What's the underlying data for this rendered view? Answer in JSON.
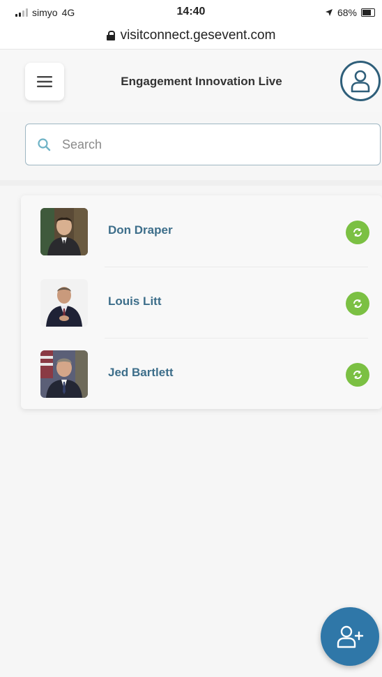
{
  "status_bar": {
    "carrier": "simyo",
    "network": "4G",
    "time": "14:40",
    "battery": "68%"
  },
  "browser": {
    "url": "visitconnect.gesevent.com"
  },
  "header": {
    "title": "Engagement Innovation Live",
    "menu_icon": "hamburger-menu-icon",
    "profile_icon": "user-profile-icon"
  },
  "search": {
    "placeholder": "Search",
    "value": "",
    "icon": "search-icon"
  },
  "contacts": [
    {
      "name": "Don Draper",
      "status_icon": "sync-icon",
      "status_color": "#7bc043"
    },
    {
      "name": "Louis Litt",
      "status_icon": "sync-icon",
      "status_color": "#7bc043"
    },
    {
      "name": "Jed Bartlett",
      "status_icon": "sync-icon",
      "status_color": "#7bc043"
    }
  ],
  "fab": {
    "icon": "add-user-icon",
    "color": "#2f77a8"
  },
  "colors": {
    "accent": "#2f77a8",
    "name_text": "#3d6e8a",
    "status_green": "#7bc043",
    "profile_border": "#2f5f7a"
  }
}
